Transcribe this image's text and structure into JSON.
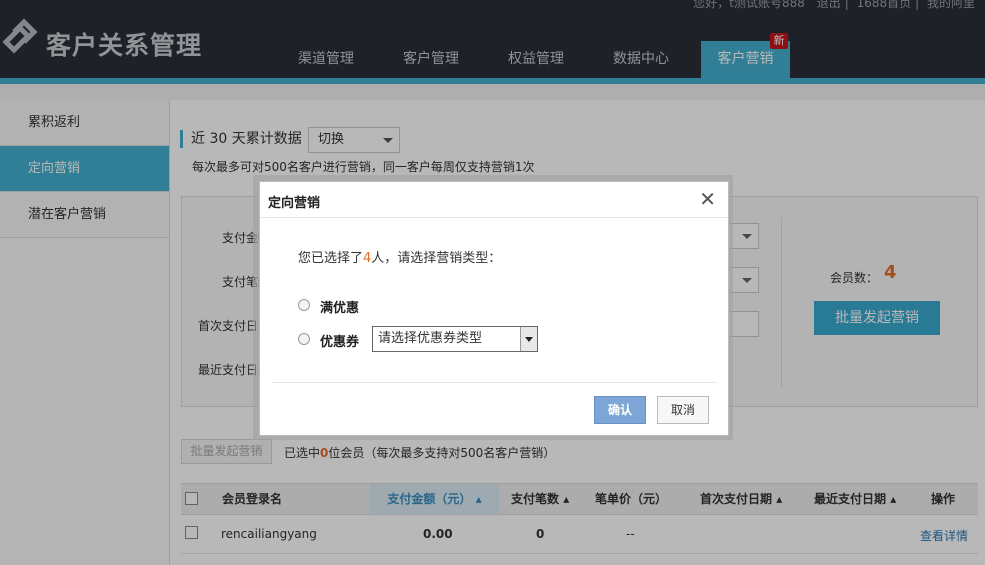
{
  "app": {
    "title": "客户关系管理",
    "topbar": [
      "您好，t测试账号888",
      "退出",
      "1688首页",
      "我的阿里"
    ]
  },
  "nav": {
    "items": [
      {
        "label": "渠道管理"
      },
      {
        "label": "客户管理"
      },
      {
        "label": "权益管理"
      },
      {
        "label": "数据中心"
      },
      {
        "label": "客户营销",
        "badge": "新"
      }
    ],
    "active_index": 4
  },
  "sidebar": {
    "items": [
      {
        "label": "累积返利"
      },
      {
        "label": "定向营销"
      },
      {
        "label": "潜在客户营销"
      }
    ],
    "active_index": 1
  },
  "main": {
    "section_title": "近 30 天累计数据",
    "switch_select": "切换",
    "note": "每次最多可对500名客户进行营销，同一客户每周仅支持营销1次",
    "filters": {
      "labels": [
        "支付金额",
        "支付笔数",
        "首次支付日期",
        "最近支付日期"
      ]
    },
    "member_count_label": "会员数：",
    "member_count": "4",
    "batch_button": "批量发起营销",
    "selection": {
      "button": "批量发起营销",
      "prefix": "已选中",
      "count": "0",
      "suffix": "位会员（每次最多支持对500名客户营销）"
    },
    "table": {
      "columns": [
        "会员登录名",
        "支付金额（元）",
        "支付笔数",
        "笔单价（元）",
        "首次支付日期",
        "最近支付日期",
        "操作"
      ],
      "rows": [
        {
          "member": "rencailiangyang",
          "amount": "0.00",
          "count": "0",
          "unit_price": "--",
          "first_date": "",
          "last_date": "",
          "action": "查看详情"
        }
      ]
    }
  },
  "dialog": {
    "title": "定向营销",
    "message_prefix": "您已选择了",
    "count": "4",
    "message_suffix": "人，请选择营销类型：",
    "options": [
      {
        "label": "满优惠"
      },
      {
        "label": "优惠券"
      }
    ],
    "coupon_placeholder": "请选择优惠券类型",
    "confirm": "确认",
    "cancel": "取消"
  },
  "colors": {
    "header_bg": "#2b2f3a",
    "accent": "#45b0d0",
    "highlight_number": "#e56b2a",
    "confirm_button": "#7da6d6"
  }
}
